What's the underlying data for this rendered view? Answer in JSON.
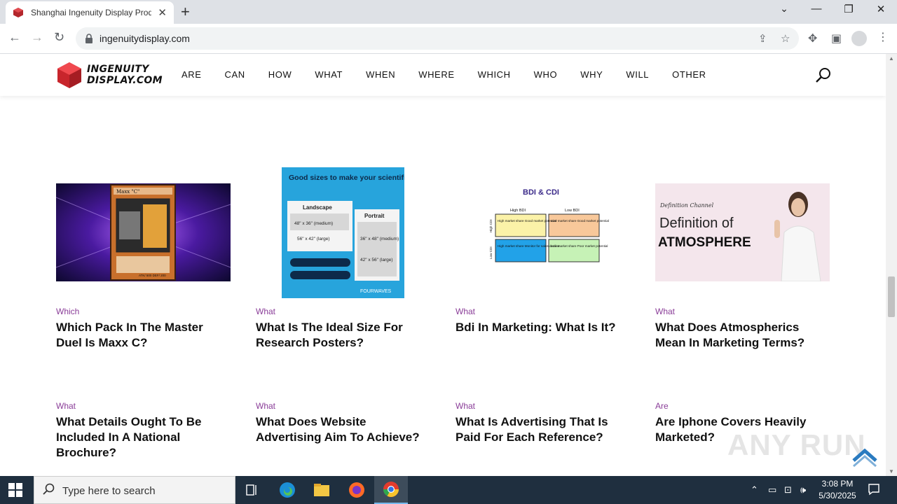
{
  "browser": {
    "tab_title": "Shanghai Ingenuity Display Prod",
    "tab_close": "✕",
    "new_tab": "+",
    "url": "ingenuitydisplay.com",
    "window_controls": {
      "minimize": "—",
      "restore": "❐",
      "close": "✕"
    }
  },
  "site": {
    "logo_line1": "INGENUITY",
    "logo_line2": "DISPLAY.COM",
    "nav": [
      "ARE",
      "CAN",
      "HOW",
      "WHAT",
      "WHEN",
      "WHERE",
      "WHICH",
      "WHO",
      "WHY",
      "WILL",
      "OTHER"
    ]
  },
  "posts": [
    {
      "category": "Which",
      "title": "Which Pack In The Master Duel Is Maxx C?"
    },
    {
      "category": "What",
      "title": "What Is The Ideal Size For Research Posters?"
    },
    {
      "category": "What",
      "title": "Bdi In Marketing: What Is It?"
    },
    {
      "category": "What",
      "title": "What Does Atmospherics Mean In Marketing Terms?"
    },
    {
      "category": "What",
      "title": "What Details Ought To Be Included In A National Brochure?"
    },
    {
      "category": "What",
      "title": "What Does Website Advertising Aim To Achieve?"
    },
    {
      "category": "What",
      "title": "What Is Advertising That Is Paid For Each Reference?"
    },
    {
      "category": "Are",
      "title": "Are Iphone Covers Heavily Marketed?"
    }
  ],
  "images": {
    "card": {
      "name": "Maxx \"C\"",
      "text": "ATK/ 500  DEF/ 200"
    },
    "poster": {
      "title": "Good sizes to make your scientific poster...",
      "landscape_label": "Landscape",
      "landscape_sizes": [
        "48\" x 36\" (medium)",
        "56\" x 42\" (large)"
      ],
      "portrait_label": "Portrait",
      "portrait_sizes": [
        "36\" x 48\" (medium)",
        "42\" x 56\" (large)"
      ],
      "brand": "FOURWAVES"
    },
    "bdi": {
      "title": "BDI & CDI",
      "col1": "High BDI",
      "col2": "Low BDI",
      "row1": "High CDI",
      "row2": "Low CDI",
      "cells": [
        "High market share Good market potential",
        "Low market share Good market potential",
        "High market share Monitor for sales decline",
        "Low market share Poor market potential"
      ]
    },
    "atmosphere": {
      "channel": "Definition Channel",
      "line1": "Definition of",
      "line2": "ATMOSPHERE"
    }
  },
  "watermark": "ANY RUN",
  "taskbar": {
    "search_placeholder": "Type here to search",
    "time": "3:08 PM",
    "date": "5/30/2025"
  }
}
